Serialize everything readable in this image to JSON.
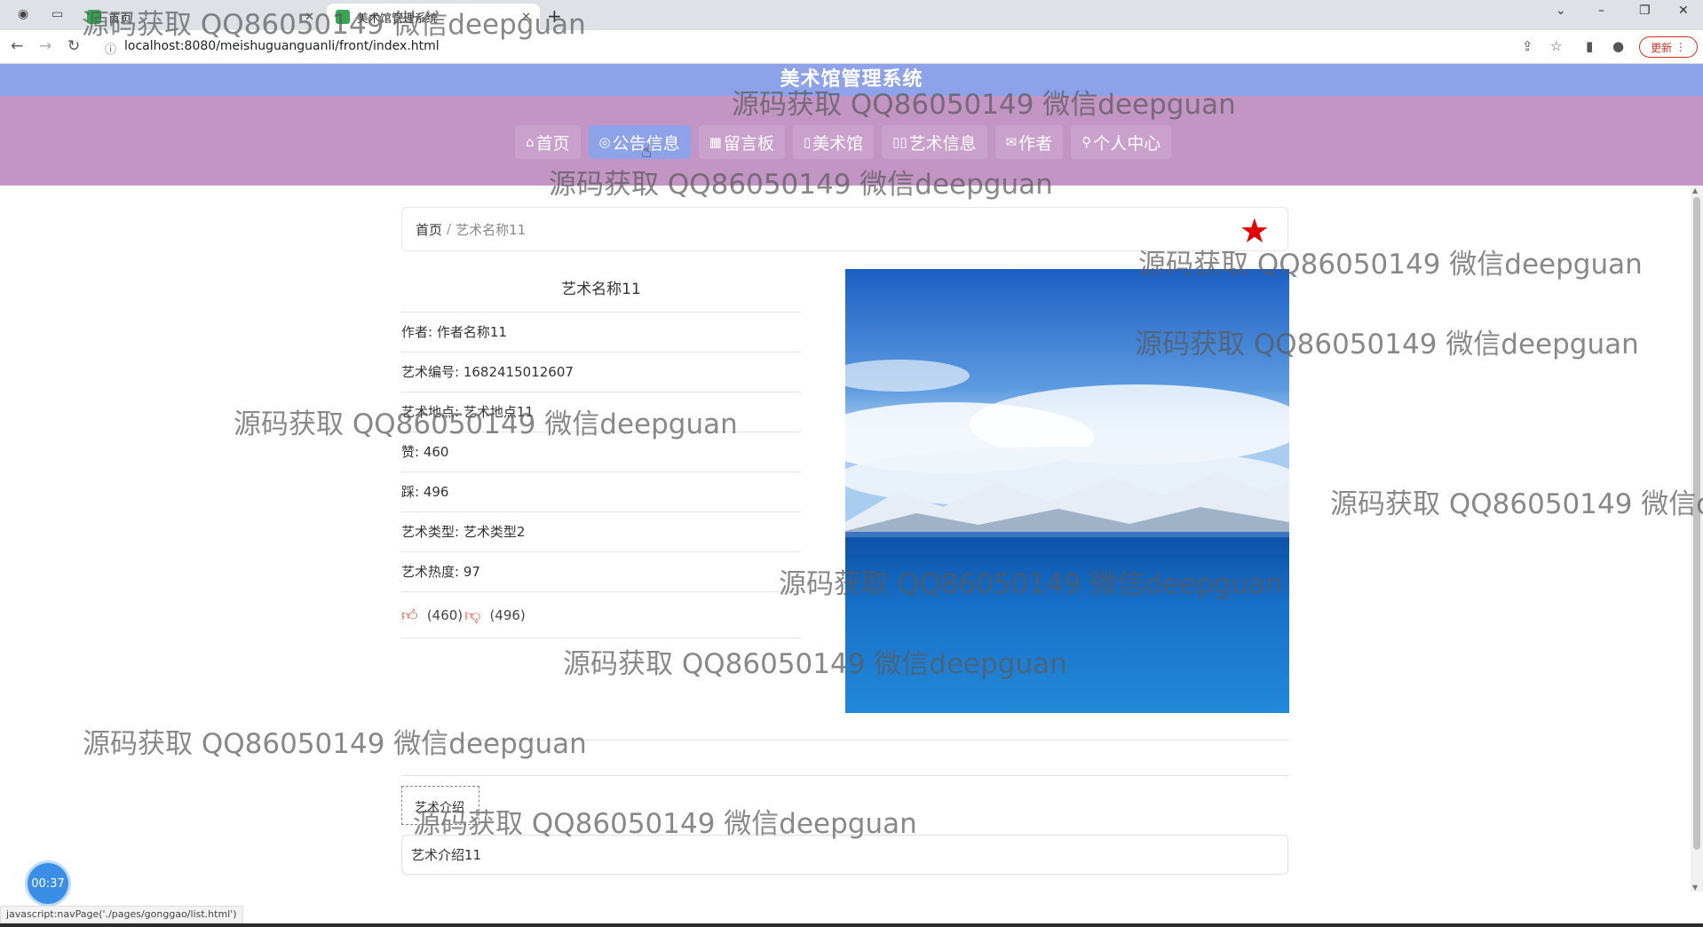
{
  "browser": {
    "tabs": [
      {
        "title": "首页"
      },
      {
        "title": "美术馆管理系统"
      }
    ],
    "url": "localhost:8080/meishuguanguanli/front/index.html",
    "update_label": "更新"
  },
  "header": {
    "system_title": "美术馆管理系统"
  },
  "menu": {
    "items": [
      {
        "icon": "⌂",
        "label": "首页"
      },
      {
        "icon": "◎",
        "label": "公告信息"
      },
      {
        "icon": "▦",
        "label": "留言板"
      },
      {
        "icon": "▯",
        "label": "美术馆"
      },
      {
        "icon": "▯▯",
        "label": "艺术信息"
      },
      {
        "icon": "✉",
        "label": "作者"
      },
      {
        "icon": "⚲",
        "label": "个人中心"
      }
    ],
    "active_index": 1
  },
  "breadcrumb": {
    "home": "首页",
    "separator": "/",
    "current": "艺术名称11"
  },
  "detail": {
    "title": "艺术名称11",
    "fields": [
      {
        "label": "作者:",
        "value": "作者名称11"
      },
      {
        "label": "艺术编号:",
        "value": "1682415012607"
      },
      {
        "label": "艺术地点:",
        "value": "艺术地点11"
      },
      {
        "label": "赞:",
        "value": "460"
      },
      {
        "label": "踩:",
        "value": "496"
      },
      {
        "label": "艺术类型:",
        "value": "艺术类型2"
      },
      {
        "label": "艺术热度:",
        "value": "97"
      }
    ],
    "like_count": "(460)",
    "dislike_count": "(496)"
  },
  "intro": {
    "tab_label": "艺术介绍",
    "content": "艺术介绍11"
  },
  "timer": "00:37",
  "status_url": "javascript:navPage('./pages/gonggao/list.html')",
  "watermark": "源码获取 QQ86050149 微信deepguan",
  "colors": {
    "title_bar": "#8ea2ea",
    "menu_bar": "#c395c5",
    "star": "#e50000",
    "thumb": "#e8513d"
  }
}
